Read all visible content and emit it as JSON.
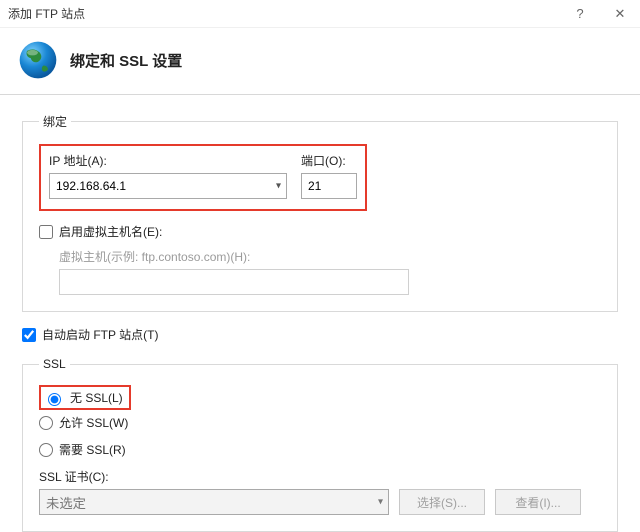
{
  "window": {
    "title": "添加 FTP 站点",
    "help": "?",
    "close": "✕"
  },
  "header": {
    "title": "绑定和 SSL 设置"
  },
  "binding": {
    "legend": "绑定",
    "ip_label": "IP 地址(A):",
    "ip_value": "192.168.64.1",
    "port_label": "端口(O):",
    "port_value": "21",
    "enable_vhost_label": "启用虚拟主机名(E):",
    "vhost_label": "虚拟主机(示例: ftp.contoso.com)(H):"
  },
  "autostart": {
    "label": "自动启动 FTP 站点(T)"
  },
  "ssl": {
    "legend": "SSL",
    "no_ssl": "无 SSL(L)",
    "allow_ssl": "允许 SSL(W)",
    "require_ssl": "需要 SSL(R)",
    "cert_label": "SSL 证书(C):",
    "cert_value": "未选定",
    "select_btn": "选择(S)...",
    "view_btn": "查看(I)..."
  }
}
